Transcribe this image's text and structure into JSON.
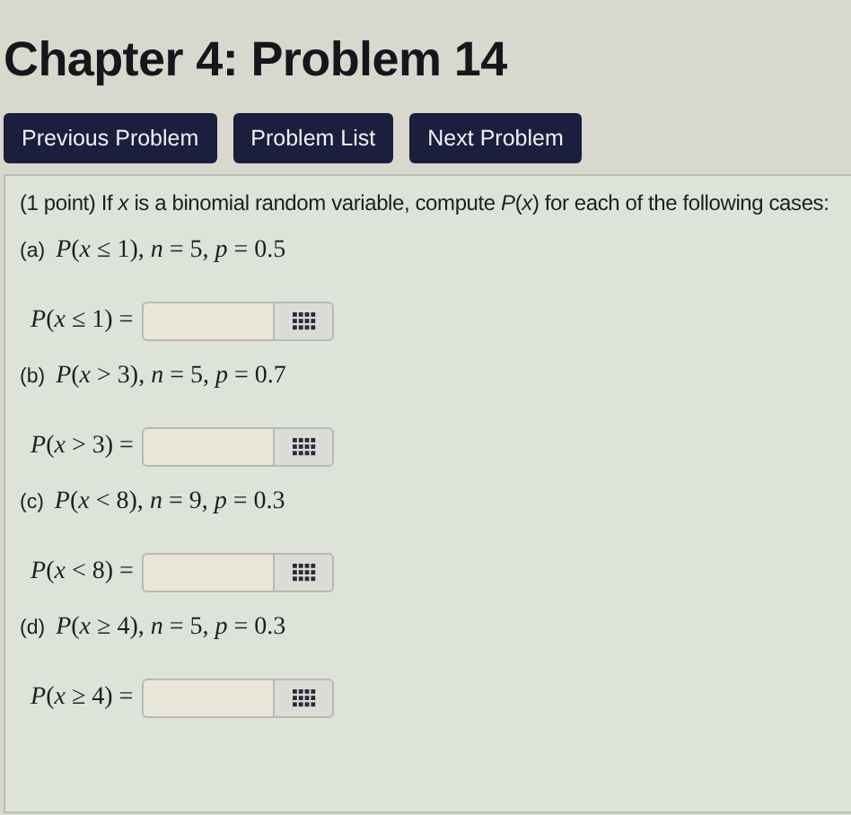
{
  "title": "Chapter 4: Problem 14",
  "nav_buttons": [
    "Previous Problem",
    "Problem List",
    "Next Problem"
  ],
  "problem": {
    "intro": "(1 point) If *x* is a binomial random variable, compute *P*(*x*) for each of the following cases:",
    "parts": [
      {
        "label": "(a)",
        "question": "*P*(*x* ≤ 1), *n* = 5, *p* = 0.5",
        "answer_label": "*P*(*x* ≤ 1) ="
      },
      {
        "label": "(b)",
        "question": "*P*(*x* > 3), *n* = 5, *p* = 0.7",
        "answer_label": "*P*(*x* > 3) ="
      },
      {
        "label": "(c)",
        "question": "*P*(*x* < 8), *n* = 9, *p* = 0.3",
        "answer_label": "*P*(*x* < 8) ="
      },
      {
        "label": "(d)",
        "question": "*P*(*x* ≥ 4), *n* = 5, *p* = 0.3",
        "answer_label": "*P*(*x* ≥ 4) ="
      }
    ]
  }
}
